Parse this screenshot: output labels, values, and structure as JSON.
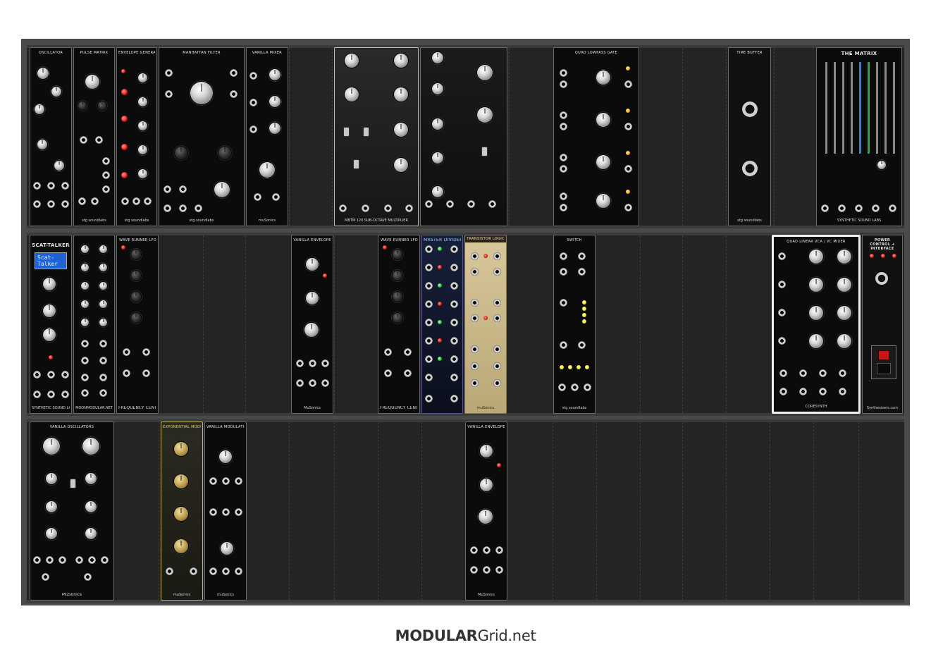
{
  "footer": {
    "brand_bold": "MODULAR",
    "brand_rest": "Grid.net"
  },
  "rows": [
    {
      "modules": [
        {
          "title": "OSCILLATOR",
          "brand": "",
          "style": "dark"
        },
        {
          "title": "PULSE MATRIX",
          "brand": "stg soundlabs",
          "style": "dark"
        },
        {
          "title": "ENVELOPE GENERATOR",
          "brand": "stg soundlabs",
          "style": "dark"
        },
        {
          "title": "MANHATTAN FILTER",
          "brand": "stg soundlabs",
          "style": "dark"
        },
        {
          "title": "VANILLA MIXER",
          "brand": "muSonics",
          "style": "dark"
        },
        {
          "title": "",
          "brand": "MBTM 120 SUB-OCTAVE MULTIPLIER",
          "style": "silver"
        },
        {
          "title": "",
          "brand": "",
          "style": "dark"
        },
        {
          "title": "QUAD LOWPASS GATE",
          "brand": "",
          "style": "dark"
        },
        {
          "title": "TIME BUFFER",
          "brand": "stg soundlabs",
          "style": "dark"
        },
        {
          "title": "THE MATRIX",
          "brand": "SYNTHETIC SOUND LABS",
          "style": "dark"
        }
      ]
    },
    {
      "modules": [
        {
          "title": "SCAT-TALKER",
          "brand": "SYNTHETIC SOUND LABS",
          "style": "dark",
          "lcd": "Scat-\nTalker"
        },
        {
          "title": "",
          "brand": "MOONMODULAR.NET",
          "style": "dark"
        },
        {
          "title": "WAVE RUNNER LFO",
          "brand": "FREQUENCY CENTRAL",
          "style": "dark"
        },
        {
          "title": "VANILLA ENVELOPE",
          "brand": "MuSonics",
          "style": "dark"
        },
        {
          "title": "WAVE RUNNER LFO",
          "brand": "FREQUENCY CENTRAL",
          "style": "dark"
        },
        {
          "title": "MASTER DIVIDER",
          "brand": "",
          "style": "navy"
        },
        {
          "title": "TRANSISTOR LOGIC",
          "brand": "muSonics",
          "style": "tan"
        },
        {
          "title": "SWITCH",
          "brand": "stg soundlabs",
          "style": "dark"
        },
        {
          "title": "QUAD LINEAR VCA / VC MIXER",
          "brand": "CORESYNTH",
          "style": "dark"
        },
        {
          "title": "POWER CONTROL + INTERFACE",
          "brand": "Synthesizers.com",
          "style": "dark"
        }
      ]
    },
    {
      "modules": [
        {
          "title": "VANILLA OSCILLATORS",
          "brand": "MuSonics",
          "style": "dark"
        },
        {
          "title": "EXPONENTIAL MODULATION",
          "brand": "muSonics",
          "style": "gold"
        },
        {
          "title": "VANILLA MODULATION",
          "brand": "muSonics",
          "style": "dark"
        },
        {
          "title": "VANILLA ENVELOPE",
          "brand": "MuSonics",
          "style": "dark"
        }
      ]
    }
  ]
}
